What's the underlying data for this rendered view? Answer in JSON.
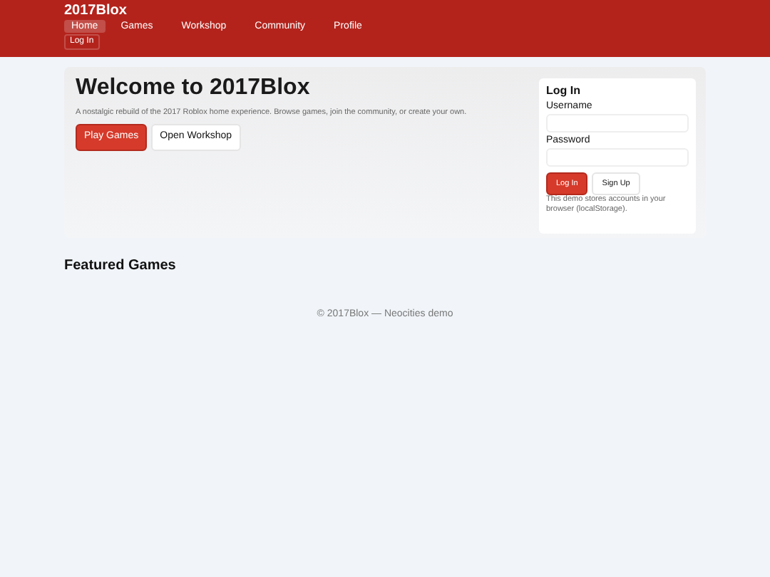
{
  "brand": "2017Blox",
  "nav": [
    {
      "label": "Home",
      "selected": true
    },
    {
      "label": "Games",
      "selected": false
    },
    {
      "label": "Workshop",
      "selected": false
    },
    {
      "label": "Community",
      "selected": false
    },
    {
      "label": "Profile",
      "selected": false
    }
  ],
  "header_button": "Log In",
  "hero": {
    "title": "Welcome to 2017Blox",
    "text": "A nostalgic rebuild of the 2017 Roblox home experience. Browse games, join the community, or create your own.",
    "buttons": [
      {
        "label": "Play Games",
        "kind": "primary"
      },
      {
        "label": "Open Workshop",
        "kind": "secondary"
      }
    ]
  },
  "login": {
    "title": "Log In",
    "fields": [
      {
        "label": "Username"
      },
      {
        "label": "Password"
      }
    ],
    "buttons": [
      {
        "label": "Log In",
        "kind": "primary"
      },
      {
        "label": "Sign Up",
        "kind": "secondary"
      }
    ],
    "note": "This demo stores accounts in your browser (localStorage)."
  },
  "section_title": "Featured Games",
  "footer": "© 2017Blox — Neocities demo"
}
